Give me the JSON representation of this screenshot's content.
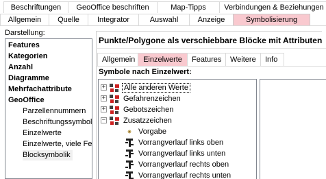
{
  "top_tabs": {
    "row1": [
      "Beschriftungen",
      "GeoOffice beschriften",
      "Map-Tipps",
      "Verbindungen & Beziehungen"
    ],
    "row2": [
      "Allgemein",
      "Quelle",
      "Integrator",
      "Auswahl",
      "Anzeige",
      "Symbolisierung"
    ],
    "active": "Symbolisierung"
  },
  "left_panel": {
    "label": "Darstellung:",
    "items": [
      {
        "label": "Features",
        "bold": true
      },
      {
        "label": "Kategorien",
        "bold": true
      },
      {
        "label": "Anzahl",
        "bold": true
      },
      {
        "label": "Diagramme",
        "bold": true
      },
      {
        "label": "Mehrfachattribute",
        "bold": true
      },
      {
        "label": "GeoOffice",
        "bold": true
      },
      {
        "label": "Parzellennummern",
        "bold": false
      },
      {
        "label": "Beschriftungssymbolik",
        "bold": false
      },
      {
        "label": "Einzelwerte",
        "bold": false
      },
      {
        "label": "Einzelwerte, viele Felder",
        "bold": false
      },
      {
        "label": "Blocksymbolik",
        "bold": false
      }
    ],
    "selected": "Blocksymbolik"
  },
  "right_panel": {
    "title": "Punkte/Polygone als verschiebbare Blöcke mit Attributen",
    "inner_tabs": [
      "Allgemein",
      "Einzelwerte",
      "Features",
      "Weitere",
      "Info"
    ],
    "active_inner_tab": "Einzelwerte",
    "symbols_label": "Symbole nach Einzelwert:",
    "tree": [
      {
        "label": "Alle anderen Werte",
        "expander": "+",
        "icon": "group-symbol-icon",
        "focused": true
      },
      {
        "label": "Gefahrenzeichen",
        "expander": "+",
        "icon": "group-symbol-icon"
      },
      {
        "label": "Gebotszeichen",
        "expander": "+",
        "icon": "group-symbol-icon"
      },
      {
        "label": "Zusatzzeichen",
        "expander": "-",
        "icon": "group-symbol-icon"
      },
      {
        "label": "Vorgabe",
        "icon": "point-symbol-icon"
      },
      {
        "label": "Vorrangverlauf links oben",
        "icon": "road-sign-symbol-icon"
      },
      {
        "label": "Vorrangverlauf links unten",
        "icon": "road-sign-symbol-icon"
      },
      {
        "label": "Vorrangverlauf rechts oben",
        "icon": "road-sign-symbol-icon"
      },
      {
        "label": "Vorrangverlauf rechts unten",
        "icon": "road-sign-symbol-icon"
      }
    ]
  },
  "colors": {
    "active_tab": "#f9c9cf",
    "symbol_red": "#cc2020",
    "symbol_dark": "#404040"
  }
}
